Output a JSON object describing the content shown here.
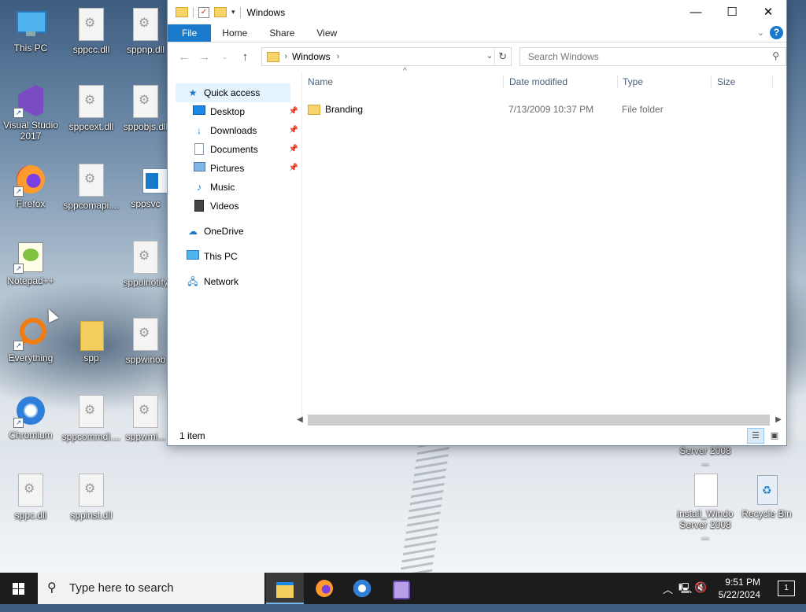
{
  "desktop": {
    "icons": [
      {
        "label": "This PC",
        "icon": "this-pc-icon"
      },
      {
        "label": "sppcc.dll",
        "icon": "dll-file-icon"
      },
      {
        "label": "sppnp.dll",
        "icon": "dll-file-icon"
      },
      {
        "label": "Visual Studio 2017",
        "icon": "visual-studio-icon"
      },
      {
        "label": "sppcext.dll",
        "icon": "dll-file-icon"
      },
      {
        "label": "sppobjs.dll",
        "icon": "dll-file-icon"
      },
      {
        "label": "Firefox",
        "icon": "firefox-icon"
      },
      {
        "label": "sppcomapi....",
        "icon": "dll-file-icon"
      },
      {
        "label": "sppsvc",
        "icon": "app-icon"
      },
      {
        "label": "Notepad++",
        "icon": "notepadpp-icon"
      },
      {
        "label": "sppuinotify",
        "icon": "dll-file-icon"
      },
      {
        "label": "Everything",
        "icon": "everything-icon"
      },
      {
        "label": "spp",
        "icon": "folder-icon"
      },
      {
        "label": "sppwinob",
        "icon": "dll-file-icon"
      },
      {
        "label": "Chromium",
        "icon": "chromium-icon"
      },
      {
        "label": "sppcommdl....",
        "icon": "dll-file-icon"
      },
      {
        "label": "sppwmi...",
        "icon": "dll-file-icon"
      },
      {
        "label": "sppc.dll",
        "icon": "dll-file-icon"
      },
      {
        "label": "sppinst.dll",
        "icon": "dll-file-icon"
      },
      {
        "label": "install_Windo Server 2008 ...",
        "icon": "file-icon"
      },
      {
        "label": "Recycle Bin",
        "icon": "recycle-bin-icon"
      },
      {
        "label": "Server 2008 ...",
        "icon": "file-icon"
      }
    ]
  },
  "explorer": {
    "title": "Windows",
    "ribbon_tabs": [
      "File",
      "Home",
      "Share",
      "View"
    ],
    "address": {
      "crumb": "Windows"
    },
    "search": {
      "placeholder": "Search Windows"
    },
    "nav": {
      "quick_access": "Quick access",
      "items": [
        {
          "label": "Desktop",
          "icon": "desktop-icon",
          "pinned": true
        },
        {
          "label": "Downloads",
          "icon": "downloads-icon",
          "pinned": true
        },
        {
          "label": "Documents",
          "icon": "documents-icon",
          "pinned": true
        },
        {
          "label": "Pictures",
          "icon": "pictures-icon",
          "pinned": true
        },
        {
          "label": "Music",
          "icon": "music-icon",
          "pinned": false
        },
        {
          "label": "Videos",
          "icon": "videos-icon",
          "pinned": false
        }
      ],
      "onedrive": "OneDrive",
      "this_pc": "This PC",
      "network": "Network"
    },
    "columns": {
      "name": "Name",
      "date": "Date modified",
      "type": "Type",
      "size": "Size"
    },
    "rows": [
      {
        "name": "Branding",
        "date": "7/13/2009 10:37 PM",
        "type": "File folder",
        "size": ""
      }
    ],
    "status": "1 item"
  },
  "taskbar": {
    "search_text": "Type here to search",
    "apps": [
      "file-explorer-icon",
      "firefox-icon",
      "chromium-icon",
      "app-icon"
    ],
    "time": "9:51 PM",
    "date": "5/22/2024",
    "notifications": "1"
  }
}
